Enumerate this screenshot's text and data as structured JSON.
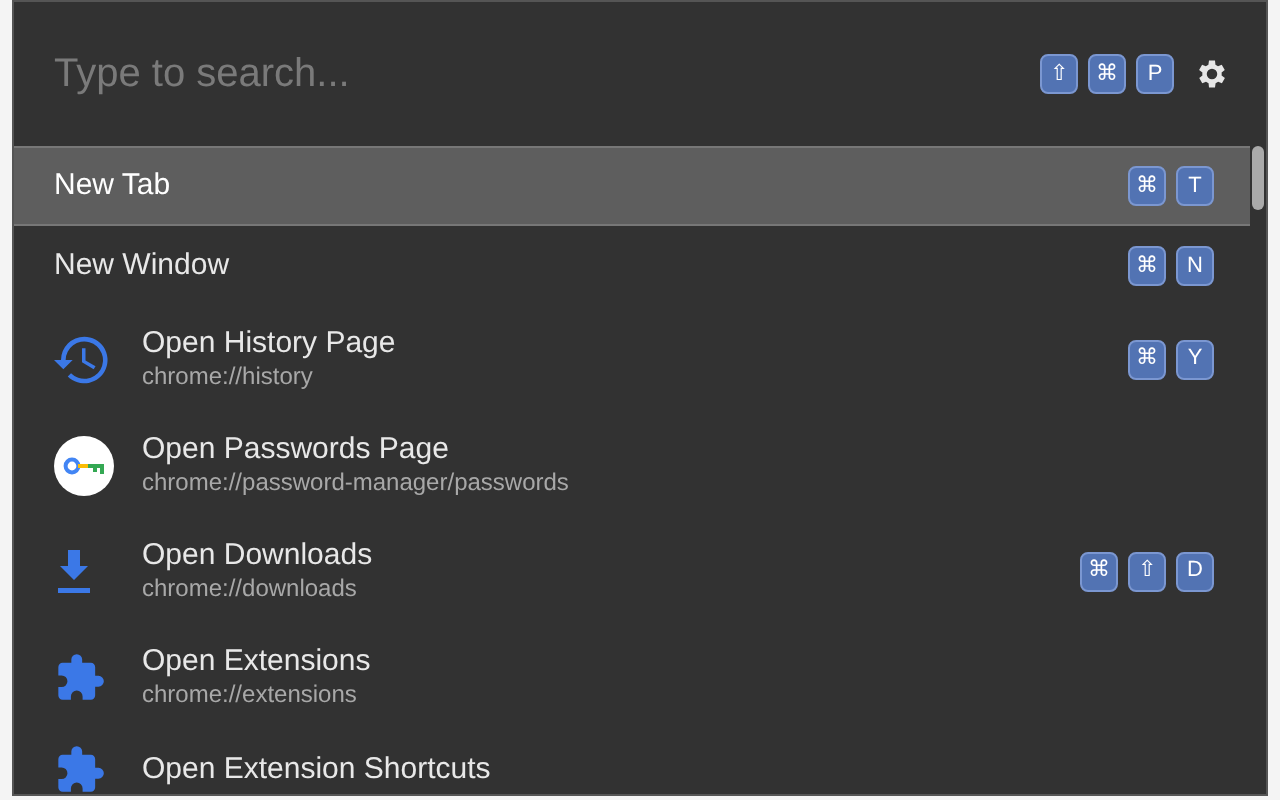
{
  "search": {
    "placeholder": "Type to search...",
    "keys": [
      "⇧",
      "⌘",
      "P"
    ]
  },
  "items": [
    {
      "kind": "plain",
      "title": "New Tab",
      "selected": true,
      "keys": [
        "⌘",
        "T"
      ]
    },
    {
      "kind": "plain",
      "title": "New Window",
      "selected": false,
      "keys": [
        "⌘",
        "N"
      ]
    },
    {
      "kind": "history",
      "title": "Open History Page",
      "url": "chrome://history",
      "selected": false,
      "keys": [
        "⌘",
        "Y"
      ]
    },
    {
      "kind": "passwords",
      "title": "Open Passwords Page",
      "url": "chrome://password-manager/passwords",
      "selected": false
    },
    {
      "kind": "downloads",
      "title": "Open Downloads",
      "url": "chrome://downloads",
      "selected": false,
      "keys": [
        "⌘",
        "⇧",
        "D"
      ]
    },
    {
      "kind": "extensions",
      "title": "Open Extensions",
      "url": "chrome://extensions",
      "selected": false
    },
    {
      "kind": "extensions",
      "title": "Open Extension Shortcuts",
      "selected": false
    }
  ]
}
